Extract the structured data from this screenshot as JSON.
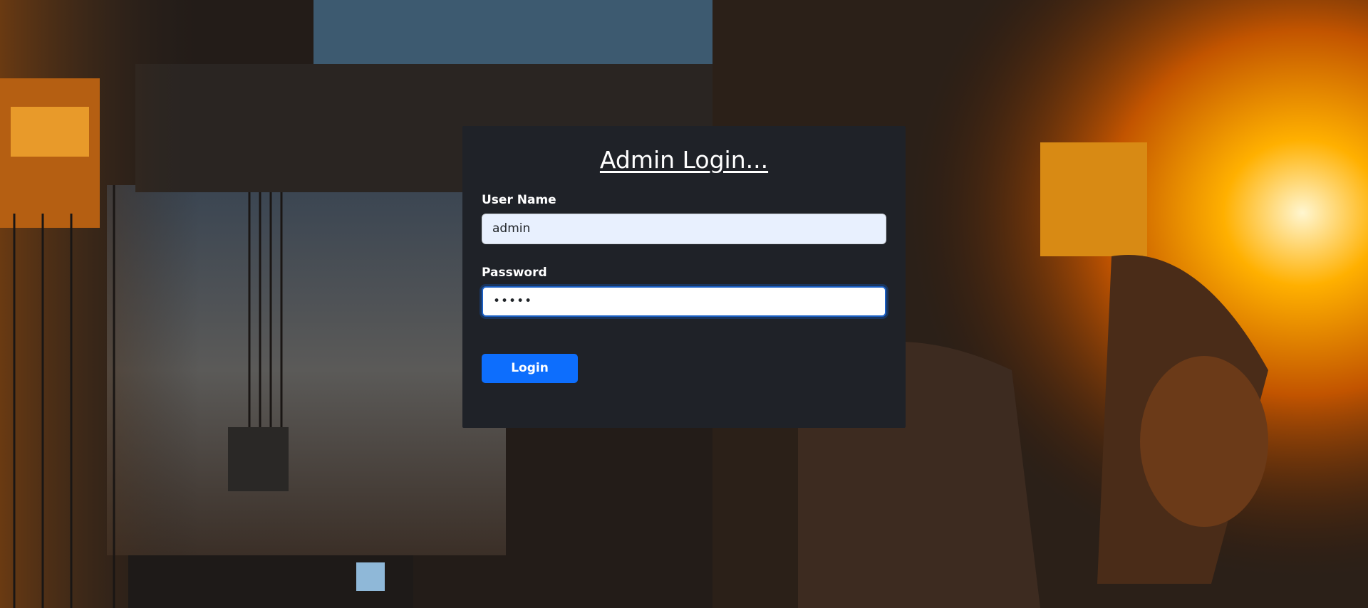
{
  "page": {
    "title": "Admin Login..."
  },
  "form": {
    "username": {
      "label": "User Name",
      "value": "admin"
    },
    "password": {
      "label": "Password",
      "value": "•••••"
    },
    "submit_label": "Login"
  },
  "colors": {
    "card_background": "#1f2228",
    "button_primary": "#0d6efd",
    "autofill_background": "#e8f0fe",
    "focus_border": "#1a5fc4"
  }
}
